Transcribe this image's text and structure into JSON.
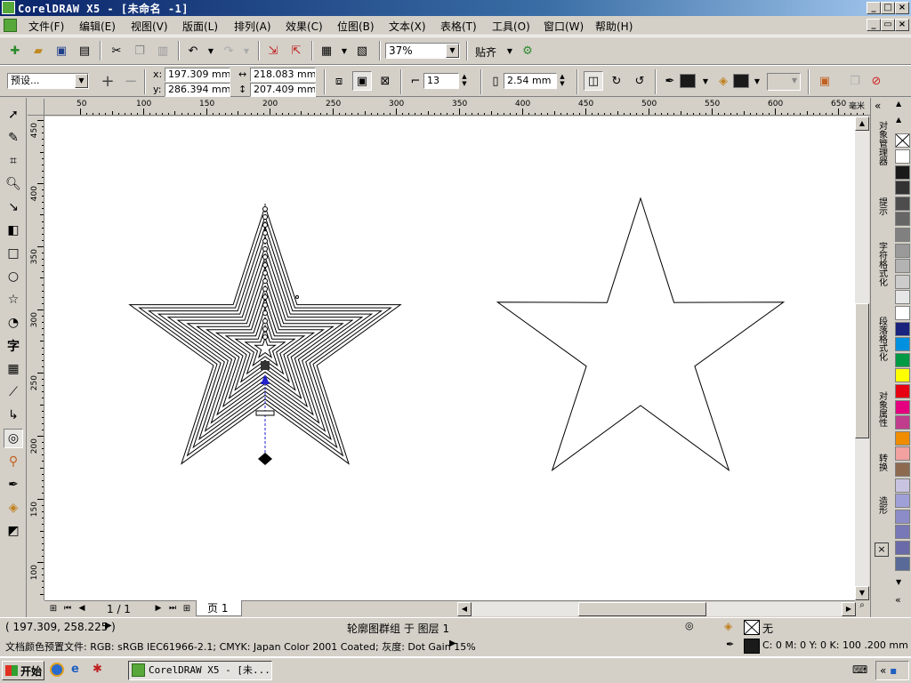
{
  "window": {
    "title": "CorelDRAW X5 - [未命名 -1]"
  },
  "menu": [
    "文件(F)",
    "编辑(E)",
    "视图(V)",
    "版面(L)",
    "排列(A)",
    "效果(C)",
    "位图(B)",
    "文本(X)",
    "表格(T)",
    "工具(O)",
    "窗口(W)",
    "帮助(H)"
  ],
  "toolbar": {
    "zoom": "37%",
    "snap_label": "贴齐"
  },
  "property_bar": {
    "preset": "预设...",
    "x_label": "x:",
    "x": "197.309 mm",
    "y_label": "y:",
    "y": "286.394 mm",
    "width": "218.083 mm",
    "height": "207.409 mm",
    "steps": "13",
    "offset": "2.54 mm"
  },
  "ruler": {
    "unit": "毫米",
    "h_labels": [
      "50",
      "100",
      "150",
      "200",
      "250",
      "300",
      "350",
      "400",
      "450",
      "500",
      "550",
      "600",
      "650"
    ],
    "v_labels": [
      "450",
      "400",
      "350",
      "300",
      "250",
      "200",
      "150",
      "100"
    ]
  },
  "pagebar": {
    "counter": "1 / 1",
    "page_tab": "页 1"
  },
  "dockers": [
    "对象管理器",
    "提示",
    "字符格式化",
    "段落格式化",
    "对象属性",
    "转换",
    "造形"
  ],
  "palette": [
    "#ffffff",
    "#1a1a1a",
    "#333333",
    "#4d4d4d",
    "#666666",
    "#808080",
    "#999999",
    "#b3b3b3",
    "#cccccc",
    "#e6e6e6",
    "#ffffff",
    "#1a237e",
    "#0090e0",
    "#009944",
    "#ffff00",
    "#e60012",
    "#e4007f",
    "#c03c8c",
    "#f08c00",
    "#f2a0a0",
    "#8c6a50",
    "#c8c4e0",
    "#a0a0d8",
    "#8c8cc8",
    "#7878b8",
    "#6a6aa8",
    "#5a6a98"
  ],
  "status": {
    "coords": "( 197.309, 258.225 )",
    "object_info": "轮廓图群组 于 图层 1",
    "fill_label": "无",
    "color_profile": "文档颜色预置文件: RGB: sRGB IEC61966-2.1; CMYK: Japan Color 2001 Coated; 灰度: Dot Gain 15%",
    "outline_info": "C: 0 M: 0 Y: 0 K: 100  .200 mm"
  },
  "taskbar": {
    "start": "开始",
    "task": "CorelDRAW X5 - [未..."
  }
}
